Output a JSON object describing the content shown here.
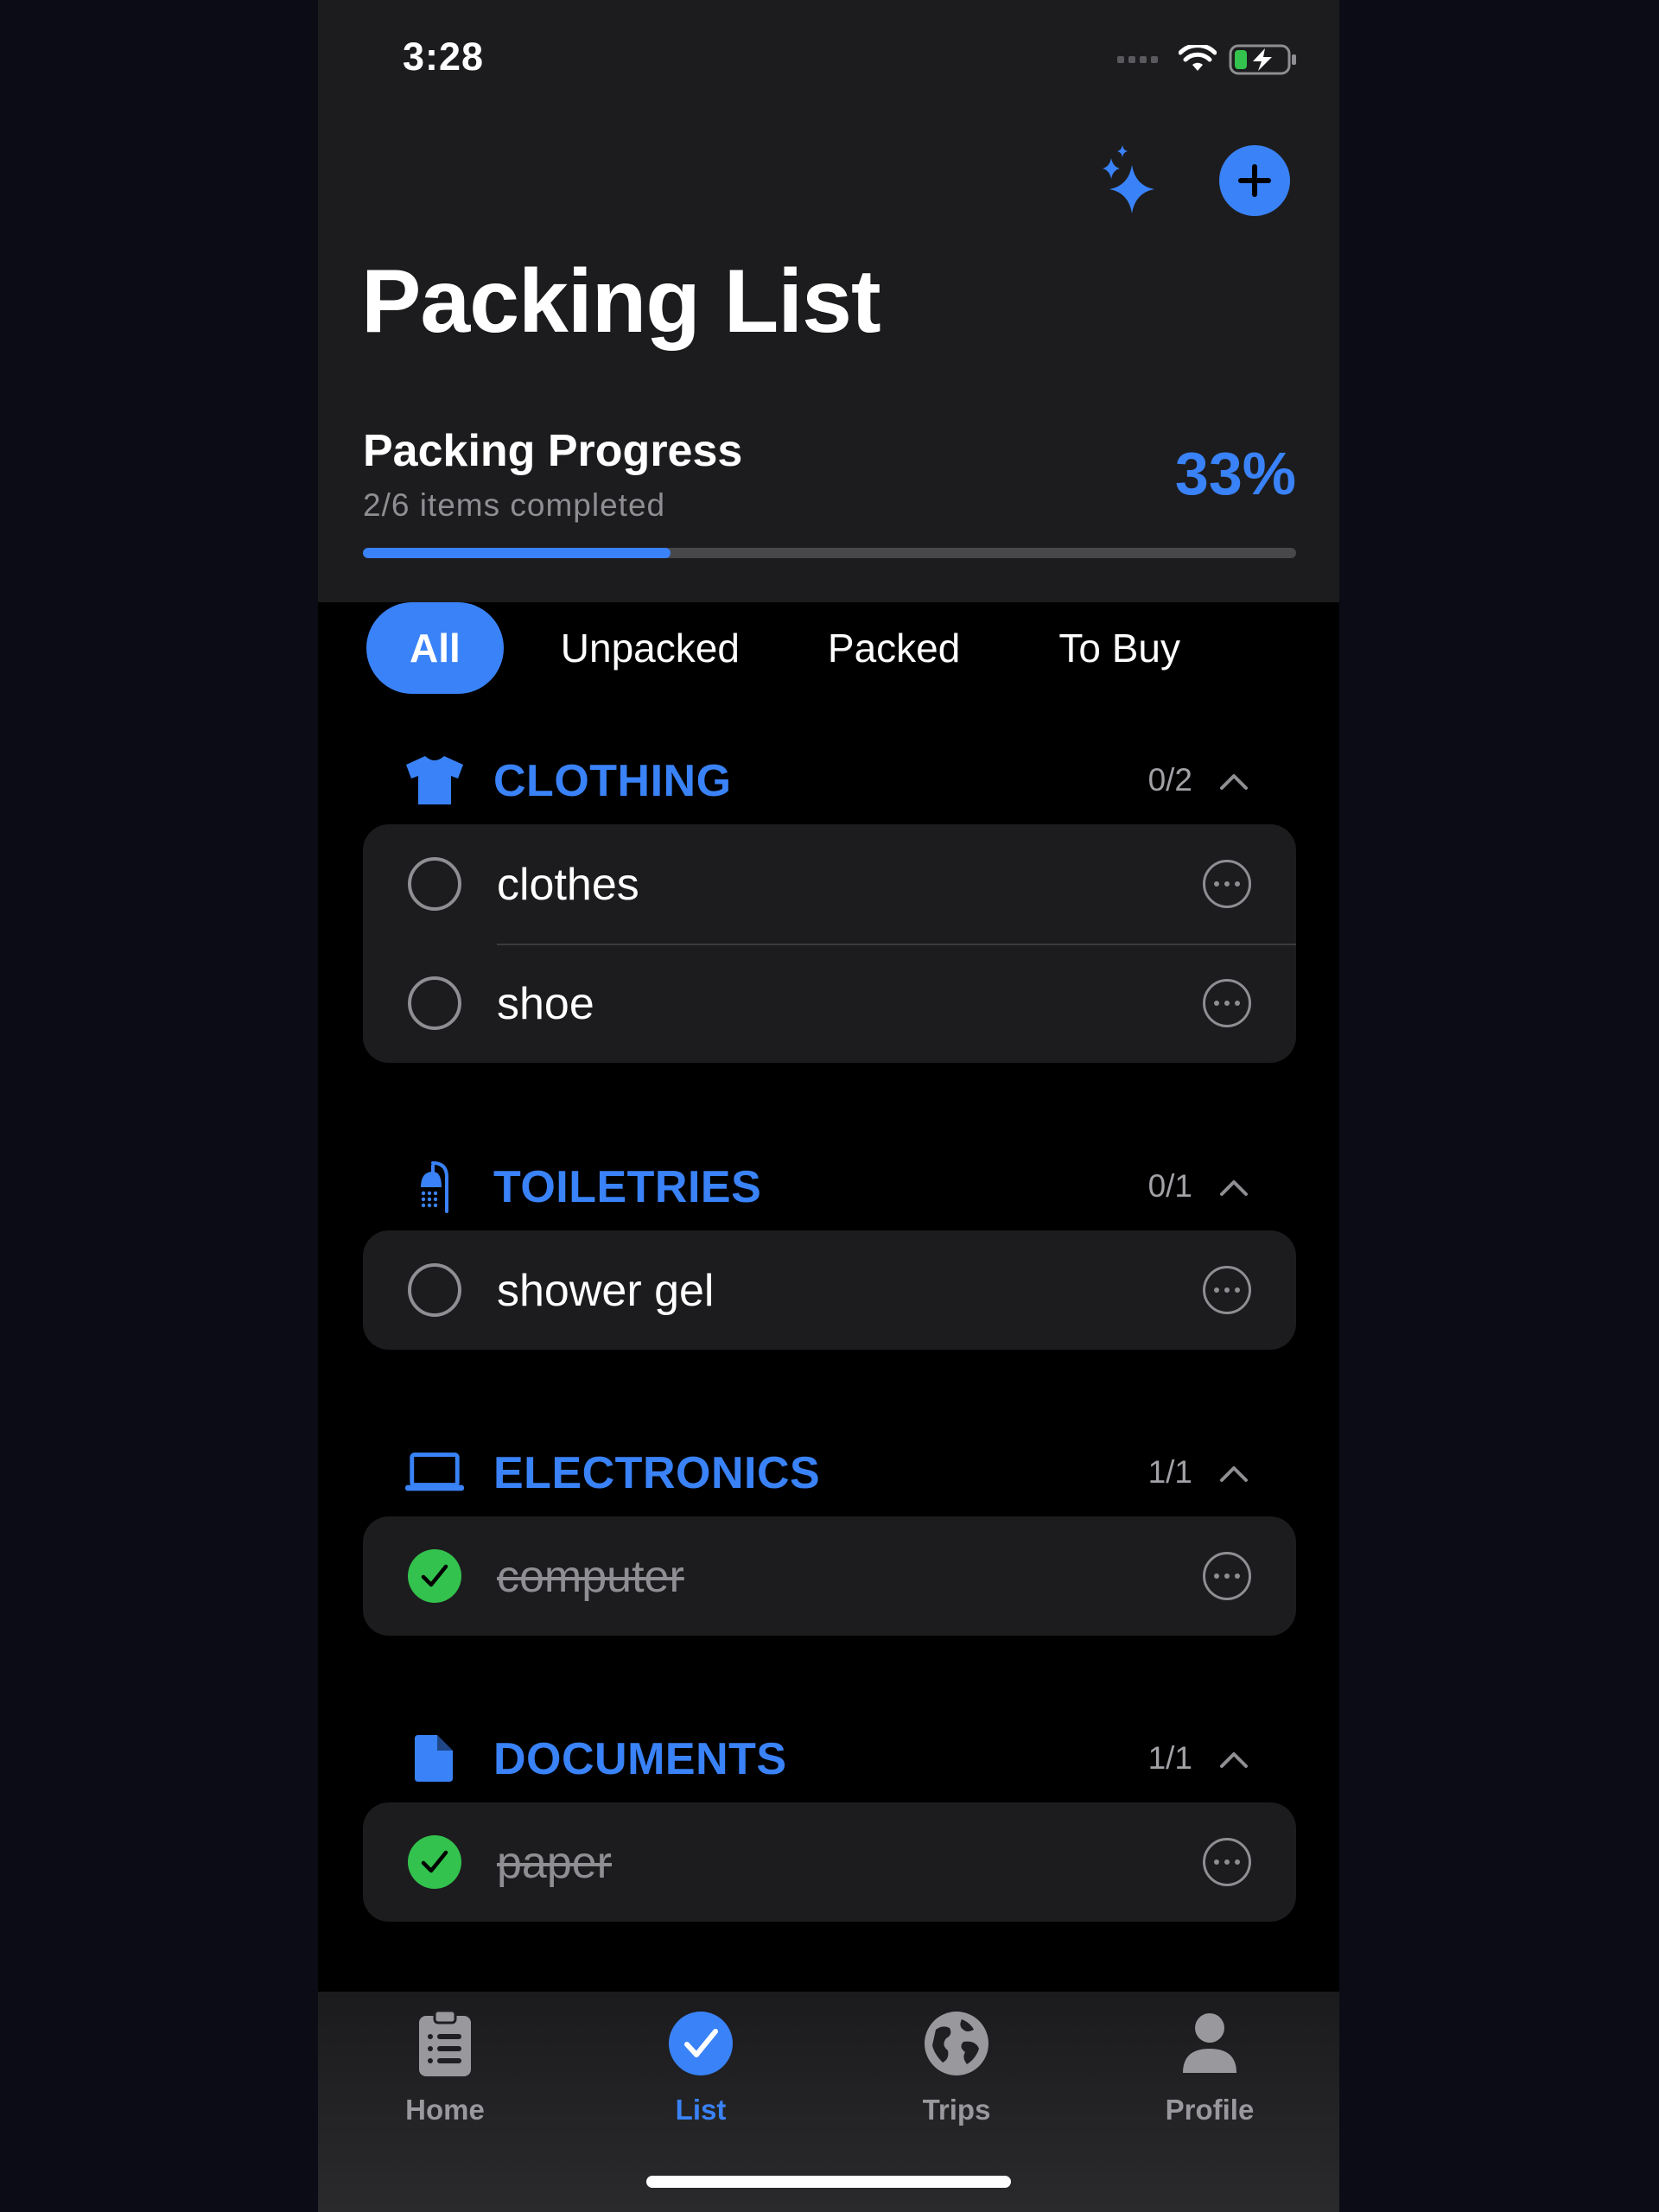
{
  "status_bar": {
    "time": "3:28"
  },
  "header": {
    "title": "Packing List",
    "sparkle_icon": "sparkles-icon",
    "add_icon": "plus-circle-icon"
  },
  "progress": {
    "title": "Packing Progress",
    "subtitle": "2/6 items completed",
    "percent_label": "33%",
    "fraction": 0.33,
    "accent_color": "#3a82f7"
  },
  "filters": {
    "tabs": [
      "All",
      "Unpacked",
      "Packed",
      "To Buy"
    ],
    "selected": "All"
  },
  "sections": [
    {
      "title": "CLOTHING",
      "count": "0/2",
      "icon": "tshirt-icon",
      "items": [
        {
          "label": "clothes",
          "packed": false
        },
        {
          "label": "shoe",
          "packed": false
        }
      ]
    },
    {
      "title": "TOILETRIES",
      "count": "0/1",
      "icon": "shower-icon",
      "items": [
        {
          "label": "shower gel",
          "packed": false
        }
      ]
    },
    {
      "title": "ELECTRONICS",
      "count": "1/1",
      "icon": "laptop-icon",
      "items": [
        {
          "label": "computer",
          "packed": true
        }
      ]
    },
    {
      "title": "DOCUMENTS",
      "count": "1/1",
      "icon": "document-icon",
      "items": [
        {
          "label": "paper",
          "packed": true
        }
      ]
    }
  ],
  "tab_bar": {
    "items": [
      {
        "label": "Home",
        "icon": "clipboard-list-icon"
      },
      {
        "label": "List",
        "icon": "checkmark-circle-icon"
      },
      {
        "label": "Trips",
        "icon": "globe-icon"
      },
      {
        "label": "Profile",
        "icon": "person-icon"
      }
    ],
    "selected": "List"
  },
  "colors": {
    "accent": "#3a82f7",
    "packed_green": "#33c24d",
    "card_background": "#1c1c1e",
    "page_background": "#000000"
  }
}
